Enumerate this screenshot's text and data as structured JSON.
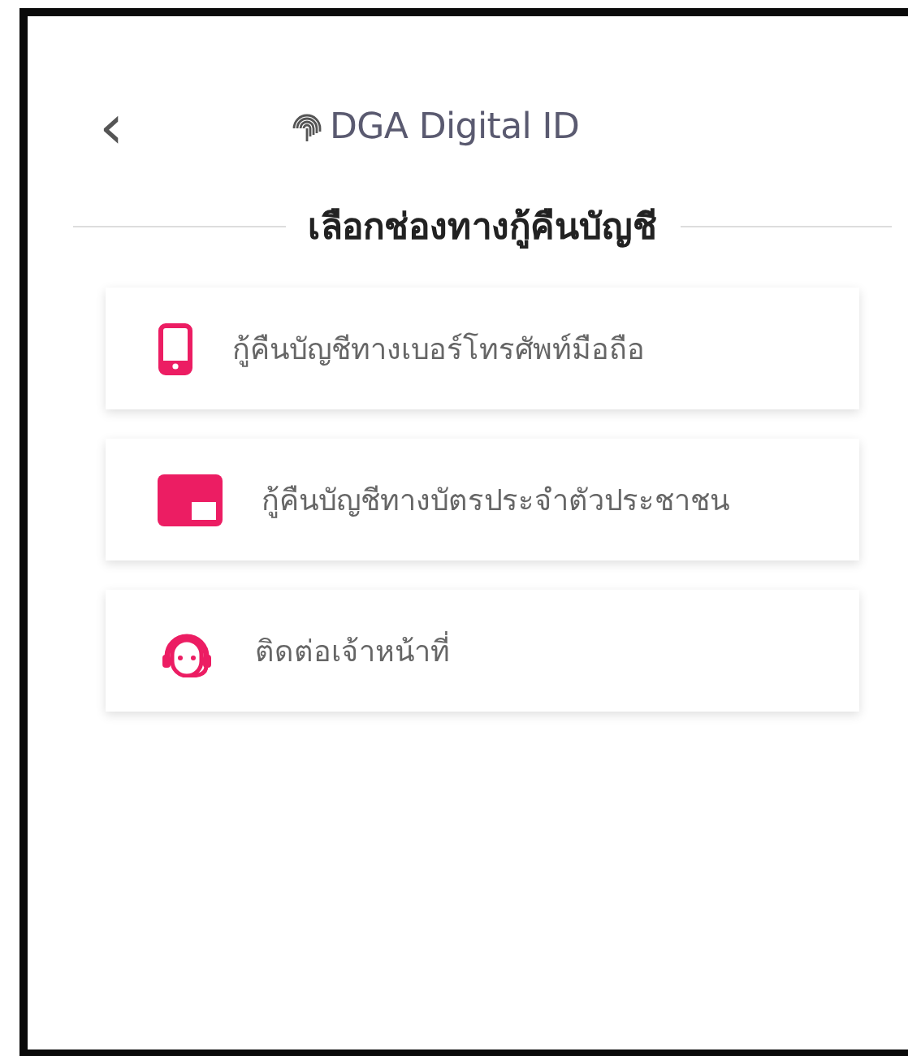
{
  "header": {
    "back": "‹",
    "brand": "DGA Digital ID"
  },
  "title": "เลือกช่องทางกู้คืนบัญชี",
  "options": [
    {
      "kind": "phone",
      "label": "กู้คืนบัญชีทางเบอร์โทรศัพท์มือถือ"
    },
    {
      "kind": "id-card",
      "label": "กู้คืนบัญชีทางบัตรประจำตัวประชาชน"
    },
    {
      "kind": "support",
      "label": "ติดต่อเจ้าหน้าที่"
    }
  ]
}
